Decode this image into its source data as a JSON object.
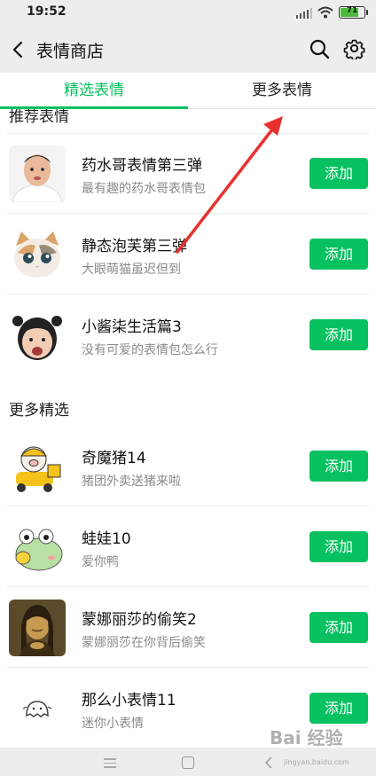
{
  "status_bar": {
    "time": "19:52",
    "battery": "71"
  },
  "header": {
    "title": "表情商店"
  },
  "tabs": [
    {
      "label": "精选表情",
      "active": true
    },
    {
      "label": "更多表情",
      "active": false
    }
  ],
  "sections": [
    {
      "title": "推荐表情",
      "items": [
        {
          "title": "药水哥表情第三弹",
          "subtitle": "最有趣的药水哥表情包",
          "button": "添加"
        },
        {
          "title": "静态泡芙第三弹",
          "subtitle": "大眼萌猫虽迟但到",
          "button": "添加"
        },
        {
          "title": "小酱柒生活篇3",
          "subtitle": "没有可爱的表情包怎么行",
          "button": "添加"
        }
      ]
    },
    {
      "title": "更多精选",
      "items": [
        {
          "title": "奇魔猪14",
          "subtitle": "猪团外卖送猪来啦",
          "button": "添加"
        },
        {
          "title": "蛙娃10",
          "subtitle": "爱你鸭",
          "button": "添加"
        },
        {
          "title": "蒙娜丽莎的偷笑2",
          "subtitle": "蒙娜丽莎在你背后偷笑",
          "button": "添加"
        },
        {
          "title": "那么小表情11",
          "subtitle": "迷你小表情",
          "button": "添加"
        }
      ]
    }
  ],
  "watermark": {
    "text": "Bai 经验",
    "sub": "jingyan.baidu.com"
  },
  "colors": {
    "accent": "#07c160",
    "annotation": "#e8322f"
  },
  "icons": [
    "back-icon",
    "search-icon",
    "gear-icon",
    "wifi-icon",
    "signal-icon",
    "battery-icon",
    "menu-icon",
    "home-icon",
    "back-nav-icon"
  ]
}
